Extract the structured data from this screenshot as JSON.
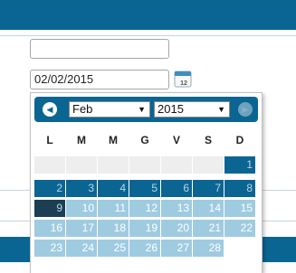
{
  "date_field": {
    "value": "02/02/2015"
  },
  "calendar_icon": {
    "day_label": "12"
  },
  "datepicker": {
    "month": "Feb",
    "year": "2015",
    "prev_glyph": "◀",
    "next_glyph": "▶",
    "dropdown_glyph": "▼",
    "weekdays": [
      "L",
      "M",
      "M",
      "G",
      "V",
      "S",
      "D"
    ],
    "weeks": [
      [
        "",
        "",
        "",
        "",
        "",
        "",
        "1"
      ],
      [
        "2",
        "3",
        "4",
        "5",
        "6",
        "7",
        "8"
      ],
      [
        "9",
        "10",
        "11",
        "12",
        "13",
        "14",
        "15"
      ],
      [
        "16",
        "17",
        "18",
        "19",
        "20",
        "21",
        "22"
      ],
      [
        "23",
        "24",
        "25",
        "26",
        "27",
        "28",
        ""
      ]
    ],
    "selected_day": "9",
    "colors": {
      "header": "#0a6593",
      "past_day": "#0a6593",
      "future_day": "#9fcbe1",
      "selected_day": "#1c3e52",
      "filler": "#eeeeee"
    }
  }
}
